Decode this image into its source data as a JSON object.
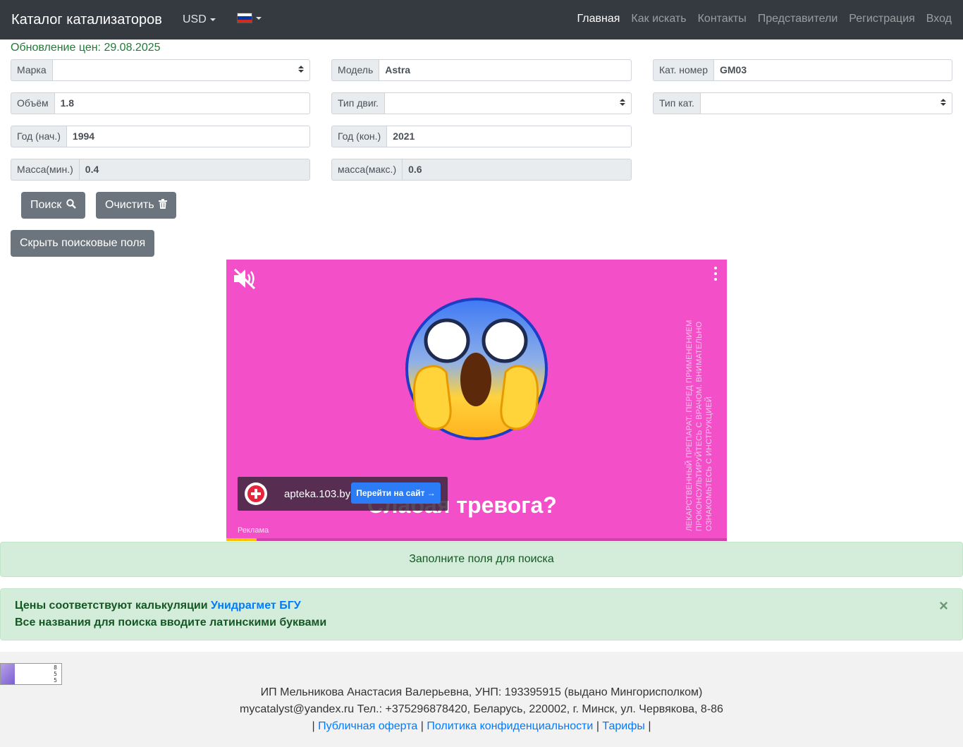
{
  "navbar": {
    "brand": "Каталог катализаторов",
    "currency": "USD",
    "language_flag": "russian-flag",
    "links": [
      "Главная",
      "Как искать",
      "Контакты",
      "Представители",
      "Регистрация",
      "Вход"
    ]
  },
  "update_text": "Обновление цен: 29.08.2025",
  "form": {
    "marka": {
      "label": "Марка",
      "value": ""
    },
    "model": {
      "label": "Модель",
      "value": "Astra"
    },
    "kat_nomer": {
      "label": "Кат. номер",
      "value": "GM03"
    },
    "volume": {
      "label": "Объём",
      "value": "1.8"
    },
    "engine_type": {
      "label": "Тип двиг.",
      "value": ""
    },
    "cat_type": {
      "label": "Тип кат.",
      "value": ""
    },
    "year_start": {
      "label": "Год (нач.)",
      "value": "1994"
    },
    "year_end": {
      "label": "Год (кон.)",
      "value": "2021"
    },
    "mass_min": {
      "label": "Масса(мин.)",
      "value": "0.4"
    },
    "mass_max": {
      "label": "масса(макс.)",
      "value": "0.6"
    }
  },
  "buttons": {
    "search": "Поиск",
    "clear": "Очистить",
    "hide_fields": "Скрыть поисковые поля"
  },
  "ad": {
    "headline": "Слабая тревога?",
    "domain": "apteka.103.by",
    "cta": "Перейти на сайт →",
    "label": "Реклама",
    "disclaimer": "Лекарственный препарат. Перед применением проконсультируйтесь с врачом. Внимательно ознакомьтесь с инструкцией",
    "progress_fraction": 0.06,
    "bg_color": "#f24fc8"
  },
  "alerts": {
    "fill_fields": "Заполните поля для поиска",
    "prices_prefix": "Цены соответствуют калькуляции ",
    "prices_link": "Унидрагмет БГУ",
    "latin_note": "Все названия для поиска вводите латинскими буквами",
    "close": "×"
  },
  "footer": {
    "counter_values": [
      "8",
      "5",
      "5"
    ],
    "line1": "ИП Мельникова Анастасия Валерьевна, УНП: 193395915 (выдано Мингорисполком)",
    "line2": "mycatalyst@yandex.ru Тел.: +375296878420, Беларусь, 220002, г. Минск, ул. Червякова, 8-86",
    "sep": "|",
    "links": [
      "Публичная оферта",
      "Политика конфиденциальности",
      "Тарифы"
    ]
  }
}
